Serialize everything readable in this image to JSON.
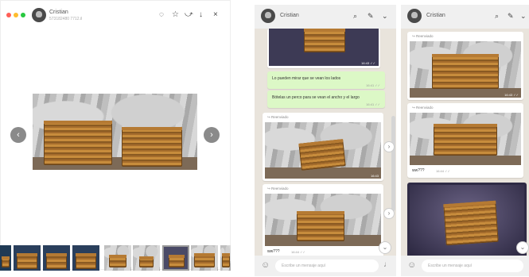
{
  "viewer": {
    "contact_name": "Cristian",
    "contact_sub": "573182480 7712.il",
    "prev_label": "‹",
    "next_label": "›",
    "toolbar_icons": [
      "speech-bubble-icon",
      "star-icon",
      "share-icon",
      "download-icon",
      "close-icon"
    ],
    "toolbar_glyphs": [
      "◌",
      "☆",
      "⤻",
      "↓",
      "×"
    ]
  },
  "chat_a": {
    "contact_name": "Cristian",
    "messages": [
      {
        "text": "Lo pueden mirar que se vean los lados",
        "time": "16:41 ✓✓"
      },
      {
        "text": "Bótelas un perco para se vean el ancho y el largo",
        "time": "16:41 ✓✓"
      }
    ],
    "forwarded_label": "↪ Reenviado",
    "img_time_1": "16:43 ✓✓",
    "img_time_2": "16:43",
    "caption": "ww???",
    "caption_time": "16:44 ✓✓",
    "input_placeholder": "Escribe un mensaje aquí"
  },
  "chat_b": {
    "contact_name": "Cristian",
    "forwarded_label": "↪ Reenviado",
    "img_time": "16:43 ✓✓",
    "caption": "ww???",
    "caption_time": "16:44 ✓✓",
    "input_placeholder": "Escribe un mensaje aquí"
  },
  "colors": {
    "outgoing_bubble": "#dcf8c6",
    "chat_bg": "#e9e4dc",
    "header_bg": "#f0f0f0",
    "mac_red": "#ff5f57",
    "mac_yellow": "#febc2e",
    "mac_green": "#28c840"
  }
}
